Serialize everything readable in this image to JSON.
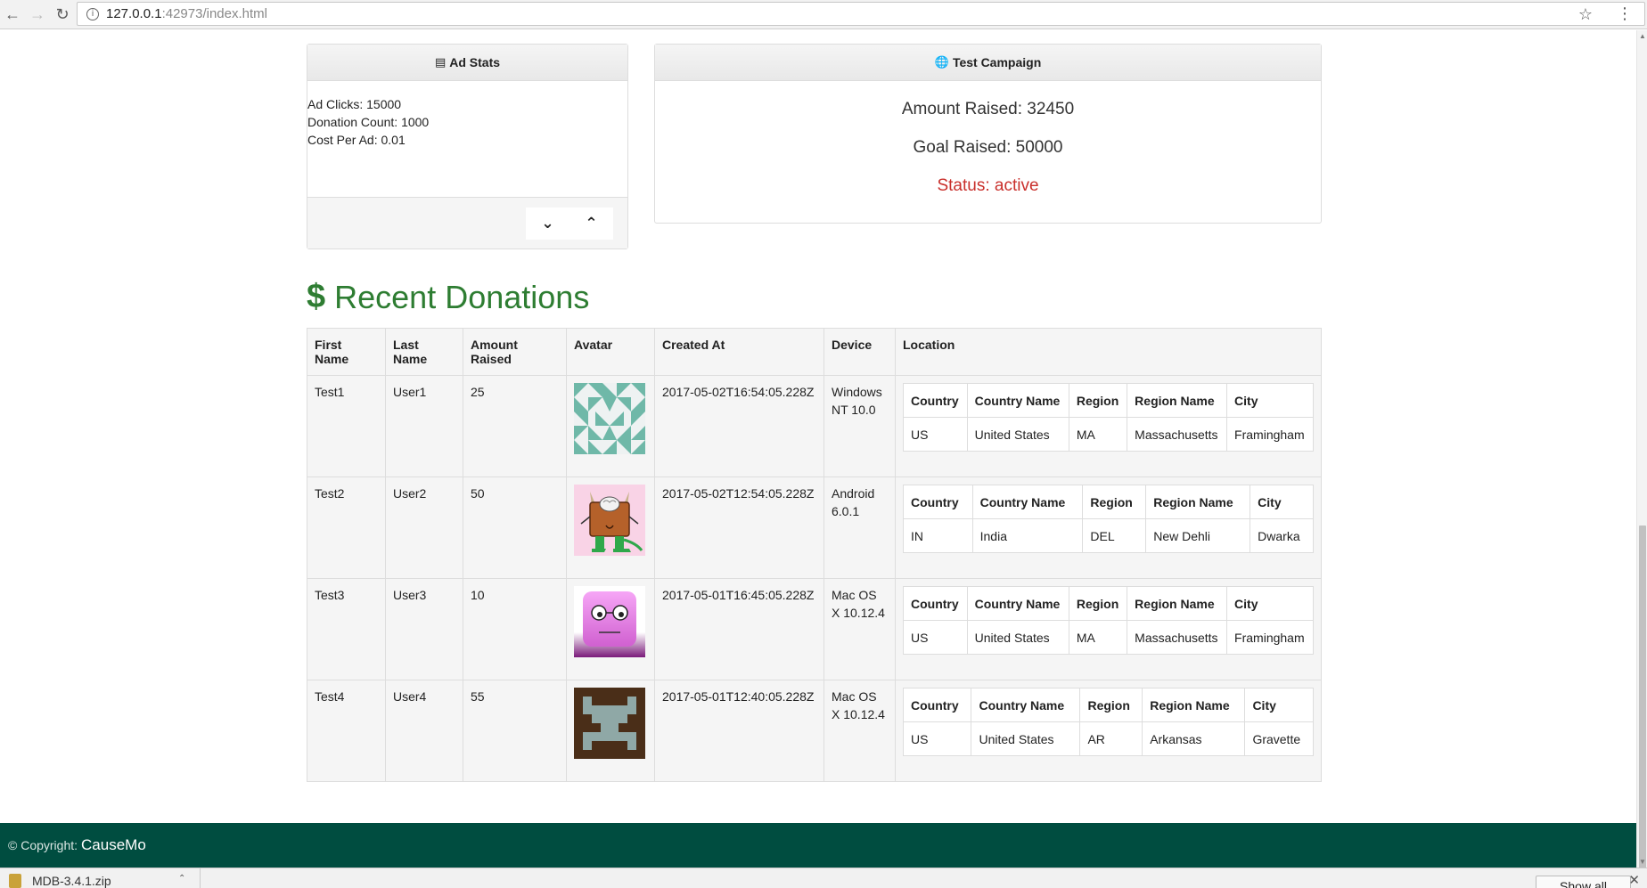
{
  "browser": {
    "url_host": "127.0.0.1",
    "url_rest": ":42973/index.html"
  },
  "ad_stats": {
    "title": "Ad Stats",
    "lines": [
      "Ad Clicks: 15000",
      "Donation Count: 1000",
      "Cost Per Ad: 0.01"
    ]
  },
  "campaign": {
    "title": "Test Campaign",
    "amount_raised": "Amount Raised: 32450",
    "goal_raised": "Goal Raised: 50000",
    "status": "Status: active",
    "status_color": "#c9302c"
  },
  "donations": {
    "title": "Recent Donations",
    "headers": [
      "First Name",
      "Last Name",
      "Amount Raised",
      "Avatar",
      "Created At",
      "Device",
      "Location"
    ],
    "location_headers": [
      "Country",
      "Country Name",
      "Region",
      "Region Name",
      "City"
    ],
    "rows": [
      {
        "first": "Test1",
        "last": "User1",
        "amount": "25",
        "avatar": "avatar-identicon",
        "created": "2017-05-02T16:54:05.228Z",
        "device": "Windows NT 10.0",
        "loc": [
          "US",
          "United States",
          "MA",
          "Massachusetts",
          "Framingham"
        ]
      },
      {
        "first": "Test2",
        "last": "User2",
        "amount": "50",
        "avatar": "avatar-monster",
        "created": "2017-05-02T12:54:05.228Z",
        "device": "Android 6.0.1",
        "loc": [
          "IN",
          "India",
          "DEL",
          "New Dehli",
          "Dwarka"
        ]
      },
      {
        "first": "Test3",
        "last": "User3",
        "amount": "10",
        "avatar": "avatar-face",
        "created": "2017-05-01T16:45:05.228Z",
        "device": "Mac OS X 10.12.4",
        "loc": [
          "US",
          "United States",
          "MA",
          "Massachusetts",
          "Framingham"
        ]
      },
      {
        "first": "Test4",
        "last": "User4",
        "amount": "55",
        "avatar": "avatar-retro",
        "created": "2017-05-01T12:40:05.228Z",
        "device": "Mac OS X 10.12.4",
        "loc": [
          "US",
          "United States",
          "AR",
          "Arkansas",
          "Gravette"
        ]
      }
    ]
  },
  "footer": {
    "copyright": "© Copyright:",
    "brand": "CauseMo",
    "background": "#004d40"
  },
  "downloads": {
    "item": "MDB-3.4.1.zip",
    "show_all": "Show all"
  }
}
